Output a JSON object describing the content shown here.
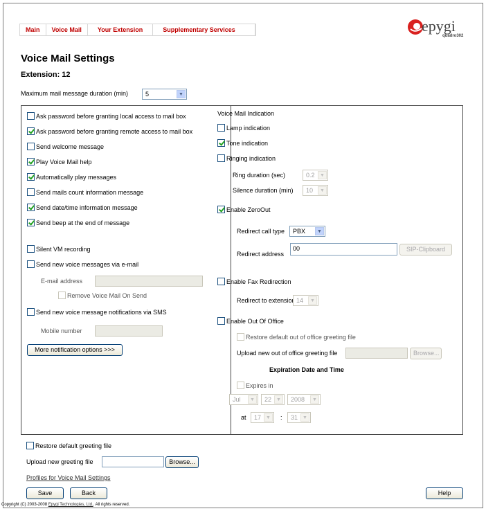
{
  "nav": {
    "items": [
      "Main",
      "Voice Mail",
      "Your Extension",
      "Supplementary Services"
    ]
  },
  "logo": {
    "name": "epygi",
    "model": "quadro302",
    "colors": {
      "swirl": "#d9211f",
      "text": "#444444"
    }
  },
  "page": {
    "title": "Voice Mail Settings",
    "extension": "Extension: 12"
  },
  "max_duration": {
    "label": "Maximum mail message duration (min)",
    "value": "5"
  },
  "left": {
    "ask_local": {
      "label": "Ask password before granting local access to mail box",
      "checked": false
    },
    "ask_remote": {
      "label": "Ask password before granting remote access to mail box",
      "checked": true
    },
    "welcome": {
      "label": "Send welcome message",
      "checked": false
    },
    "vm_help": {
      "label": "Play Voice Mail help",
      "checked": true
    },
    "auto_play": {
      "label": "Automatically play messages",
      "checked": true
    },
    "mails_count": {
      "label": "Send mails count information message",
      "checked": false
    },
    "datetime": {
      "label": "Send date/time information message",
      "checked": true
    },
    "beep": {
      "label": "Send beep at the end of message",
      "checked": true
    },
    "silent": {
      "label": "Silent VM recording",
      "checked": false
    },
    "email": {
      "label": "Send new voice messages via e-mail",
      "checked": false
    },
    "email_address_label": "E-mail address",
    "email_address_value": "",
    "remove_vm": {
      "label": "Remove Voice Mail On Send",
      "checked": false
    },
    "sms": {
      "label": "Send new voice message notifications via SMS",
      "checked": false
    },
    "mobile_label": "Mobile number",
    "mobile_value": "",
    "more_button": "More notification options >>>"
  },
  "right": {
    "indication_header": "Voice Mail Indication",
    "lamp": {
      "label": "Lamp indication",
      "checked": false
    },
    "tone": {
      "label": "Tone indication",
      "checked": true
    },
    "ringing": {
      "label": "Ringing indication",
      "checked": false
    },
    "ring_duration": {
      "label": "Ring duration (sec)",
      "value": "0.2"
    },
    "silence_duration": {
      "label": "Silence duration (min)",
      "value": "10"
    },
    "zeroout": {
      "label": "Enable ZeroOut",
      "checked": true
    },
    "redirect_type": {
      "label": "Redirect call type",
      "value": "PBX"
    },
    "redirect_address": {
      "label": "Redirect address",
      "value": "00"
    },
    "sip_clipboard": "SIP-Clipboard",
    "fax": {
      "label": "Enable Fax Redirection",
      "checked": false
    },
    "fax_ext": {
      "label": "Redirect to extension",
      "value": "14"
    },
    "ooo": {
      "label": "Enable Out Of Office",
      "checked": false
    },
    "restore_ooo": {
      "label": "Restore default out of office greeting file",
      "checked": false
    },
    "upload_ooo_label": "Upload new out of office greeting file",
    "browse": "Browse...",
    "exp_header": "Expiration Date and Time",
    "expires": {
      "label": "Expires in",
      "checked": false
    },
    "date": {
      "month": "Jul",
      "day": "22",
      "year": "2008"
    },
    "at_label": "at",
    "time": {
      "hour": "17",
      "sep": ":",
      "minute": "31"
    }
  },
  "bottom": {
    "restore_greeting": {
      "label": "Restore default greeting file",
      "checked": false
    },
    "upload_label": "Upload new greeting file",
    "browse": "Browse...",
    "profiles_link": "Profiles for Voice Mail Settings",
    "save": "Save",
    "back": "Back",
    "help": "Help"
  },
  "footer": {
    "prefix": "Copyright (C) 2003-2008",
    "company": "Epygi Technologies, Ltd.",
    "suffix": "All rights reserved."
  }
}
